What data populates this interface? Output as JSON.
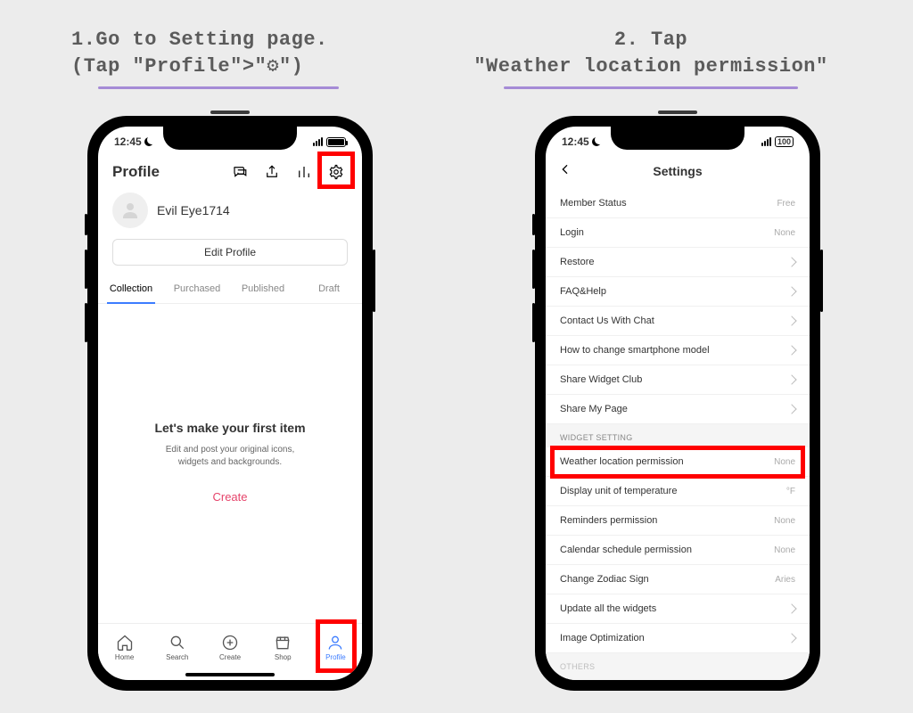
{
  "instructions": {
    "step1_line1": "1.Go to Setting page.",
    "step1_line2": "(Tap \"Profile\">\"⚙\")",
    "step2_line1": "2. Tap",
    "step2_line2": "\"Weather location permission\""
  },
  "status": {
    "time": "12:45",
    "battery_text": "100"
  },
  "profile": {
    "header_title": "Profile",
    "username": "Evil Eye1714",
    "edit_button": "Edit Profile",
    "tabs": {
      "collection": "Collection",
      "purchased": "Purchased",
      "published": "Published",
      "draft": "Draft"
    },
    "empty": {
      "title": "Let's make your first item",
      "subtitle_l1": "Edit and post your original icons,",
      "subtitle_l2": "widgets and backgrounds.",
      "create": "Create"
    },
    "tabbar": {
      "home": "Home",
      "search": "Search",
      "create": "Create",
      "shop": "Shop",
      "profile": "Profile"
    }
  },
  "settings": {
    "title": "Settings",
    "sections": {
      "widget_setting": "WIDGET SETTING",
      "others": "OTHERS"
    },
    "rows": {
      "member_status": {
        "label": "Member Status",
        "value": "Free"
      },
      "login": {
        "label": "Login",
        "value": "None"
      },
      "restore": {
        "label": "Restore",
        "chevron": true
      },
      "faq": {
        "label": "FAQ&Help",
        "chevron": true
      },
      "contact": {
        "label": "Contact Us With Chat",
        "chevron": true
      },
      "change_model": {
        "label": "How to change smartphone model",
        "chevron": true
      },
      "share_club": {
        "label": "Share Widget Club",
        "chevron": true
      },
      "share_my_page": {
        "label": "Share My Page",
        "chevron": true
      },
      "weather": {
        "label": "Weather location permission",
        "value": "None"
      },
      "temp_unit": {
        "label": "Display unit of temperature",
        "value": "°F"
      },
      "reminders": {
        "label": "Reminders permission",
        "value": "None"
      },
      "calendar": {
        "label": "Calendar schedule permission",
        "value": "None"
      },
      "zodiac": {
        "label": "Change Zodiac Sign",
        "value": "Aries"
      },
      "update_widgets": {
        "label": "Update all the widgets",
        "chevron": true
      },
      "image_opt": {
        "label": "Image Optimization",
        "chevron": true
      }
    }
  }
}
